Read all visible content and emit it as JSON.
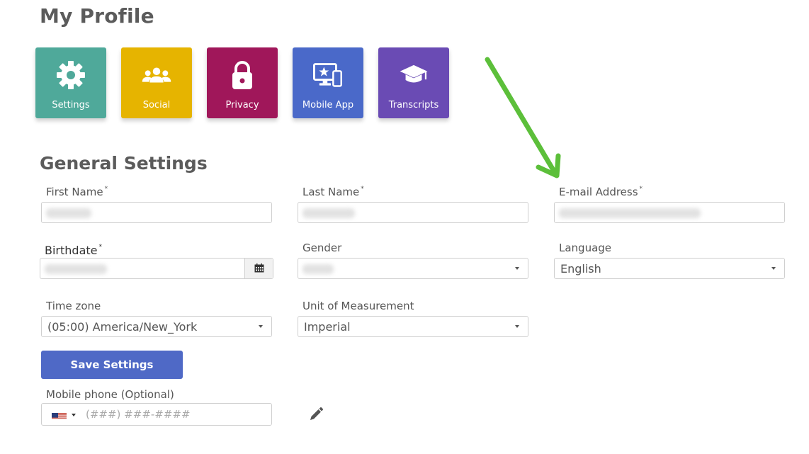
{
  "page": {
    "title": "My Profile"
  },
  "tiles": [
    {
      "label": "Settings",
      "icon": "gear-icon",
      "color": "#4fa99a"
    },
    {
      "label": "Social",
      "icon": "users-icon",
      "color": "#e6b400"
    },
    {
      "label": "Privacy",
      "icon": "lock-icon",
      "color": "#a0175a"
    },
    {
      "label": "Mobile App",
      "icon": "mobile-devices-icon",
      "color": "#4a69c9"
    },
    {
      "label": "Transcripts",
      "icon": "graduation-cap-icon",
      "color": "#6a4bb4"
    }
  ],
  "section": {
    "title": "General Settings"
  },
  "form": {
    "first_name": {
      "label": "First Name",
      "required": "*",
      "value": ""
    },
    "last_name": {
      "label": "Last Name",
      "required": "*",
      "value": ""
    },
    "email": {
      "label": "E-mail Address",
      "required": "*",
      "value": ""
    },
    "birthdate": {
      "label": "Birthdate",
      "required": "*",
      "value": "",
      "button_icon": "calendar-icon"
    },
    "gender": {
      "label": "Gender",
      "value": ""
    },
    "language": {
      "label": "Language",
      "value": "English"
    },
    "timezone": {
      "label": "Time zone",
      "value": "(05:00) America/New_York"
    },
    "unit": {
      "label": "Unit of Measurement",
      "value": "Imperial"
    },
    "save_label": "Save Settings",
    "mobile_phone": {
      "label": "Mobile phone (Optional)",
      "placeholder": "(###) ###-####",
      "country": "us-flag-icon"
    },
    "edit_icon": "pencil-icon"
  },
  "colors": {
    "accent": "#4f69c6",
    "annotation_arrow": "#5cbf3a"
  }
}
